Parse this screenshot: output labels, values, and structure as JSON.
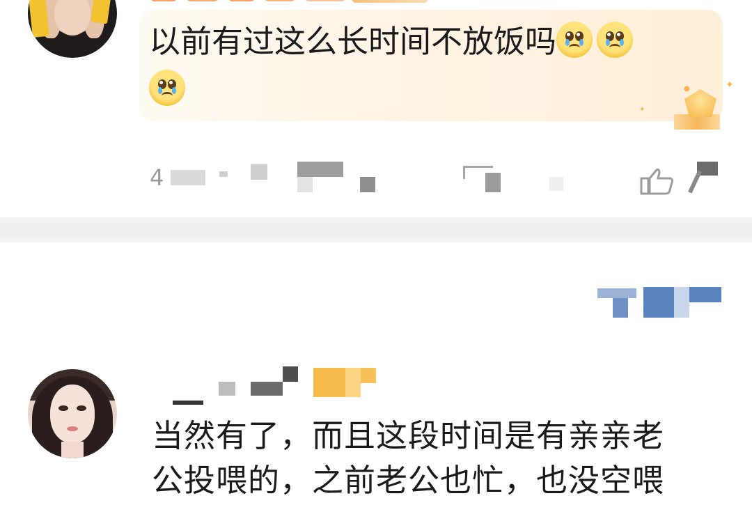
{
  "comments": [
    {
      "text": "以前有过这么长时间不放饭吗",
      "emoji_count": 3,
      "emoji_name": "crying-face",
      "time_partial": "4"
    },
    {
      "text_line1": "当然有了，而且这段时间是有亲亲老",
      "text_line2": "公投喂的，之前老公也忙，也没空喂"
    }
  ],
  "colors": {
    "bubble": "#fff3e2",
    "text": "#1a1a1a",
    "meta": "#9a9a9a",
    "link_blue": "#4f7fc0",
    "divider": "#eeeeee"
  },
  "icons": {
    "like": "thumbs-up-icon",
    "gem": "diamond-badge-icon"
  }
}
